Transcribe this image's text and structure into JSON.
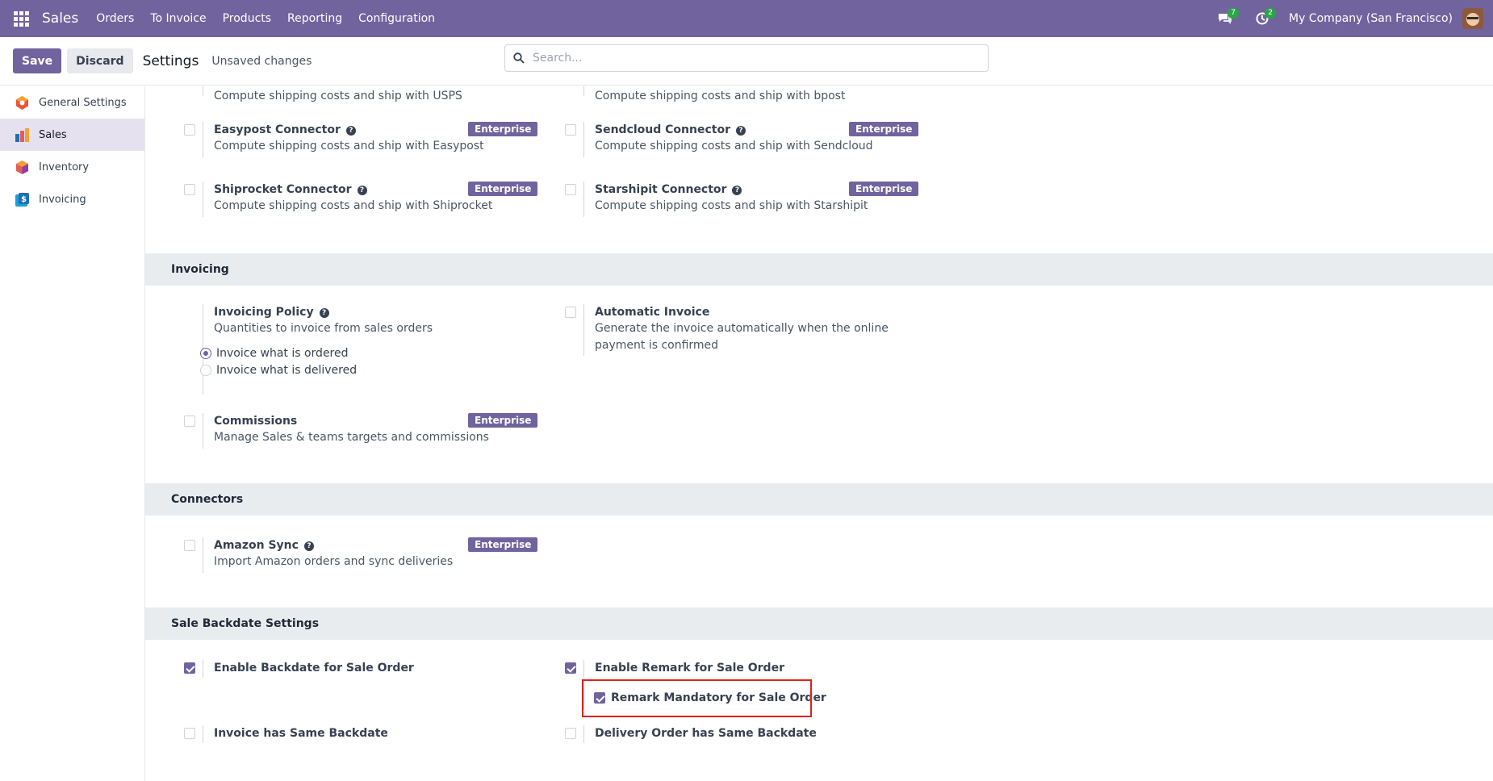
{
  "navbar": {
    "brand": "Sales",
    "menu": [
      "Orders",
      "To Invoice",
      "Products",
      "Reporting",
      "Configuration"
    ],
    "messages_count": "7",
    "activities_count": "2",
    "company": "My Company (San Francisco)"
  },
  "control": {
    "save_label": "Save",
    "discard_label": "Discard",
    "title": "Settings",
    "status": "Unsaved changes",
    "search_placeholder": "Search..."
  },
  "sidebar": {
    "items": [
      {
        "label": "General Settings",
        "icon": "odoo-logo-icon",
        "color": "#e8563a"
      },
      {
        "label": "Sales",
        "icon": "sales-app-icon",
        "color": "#b14f7b",
        "active": true
      },
      {
        "label": "Inventory",
        "icon": "inventory-app-icon",
        "color": "#e55b5b"
      },
      {
        "label": "Invoicing",
        "icon": "invoicing-app-icon",
        "color": "#1e9fd6"
      }
    ]
  },
  "shipping": {
    "usps_desc": "Compute shipping costs and ship with USPS",
    "bpost_desc": "Compute shipping costs and ship with bpost",
    "easypost": {
      "title": "Easypost Connector",
      "desc": "Compute shipping costs and ship with Easypost",
      "badge": "Enterprise"
    },
    "sendcloud": {
      "title": "Sendcloud Connector",
      "desc": "Compute shipping costs and ship with Sendcloud",
      "badge": "Enterprise"
    },
    "shiprocket": {
      "title": "Shiprocket Connector",
      "desc": "Compute shipping costs and ship with Shiprocket",
      "badge": "Enterprise"
    },
    "starshipit": {
      "title": "Starshipit Connector",
      "desc": "Compute shipping costs and ship with Starshipit",
      "badge": "Enterprise"
    }
  },
  "invoicing": {
    "heading": "Invoicing",
    "policy": {
      "title": "Invoicing Policy",
      "desc": "Quantities to invoice from sales orders",
      "option1": "Invoice what is ordered",
      "option2": "Invoice what is delivered",
      "selected": 1
    },
    "automatic": {
      "title": "Automatic Invoice",
      "desc": "Generate the invoice automatically when the online payment is confirmed"
    },
    "commissions": {
      "title": "Commissions",
      "desc": "Manage Sales & teams targets and commissions",
      "badge": "Enterprise"
    }
  },
  "connectors": {
    "heading": "Connectors",
    "amazon": {
      "title": "Amazon Sync",
      "desc": "Import Amazon orders and sync deliveries",
      "badge": "Enterprise"
    }
  },
  "backdate": {
    "heading": "Sale Backdate Settings",
    "enable_backdate": {
      "label": "Enable Backdate for Sale Order",
      "checked": true
    },
    "enable_remark": {
      "label": "Enable Remark for Sale Order",
      "checked": true
    },
    "remark_mandatory": {
      "label": "Remark Mandatory for Sale Order",
      "checked": true
    },
    "invoice_same": {
      "label": "Invoice has Same Backdate",
      "checked": false
    },
    "delivery_same": {
      "label": "Delivery Order has Same Backdate",
      "checked": false
    }
  }
}
